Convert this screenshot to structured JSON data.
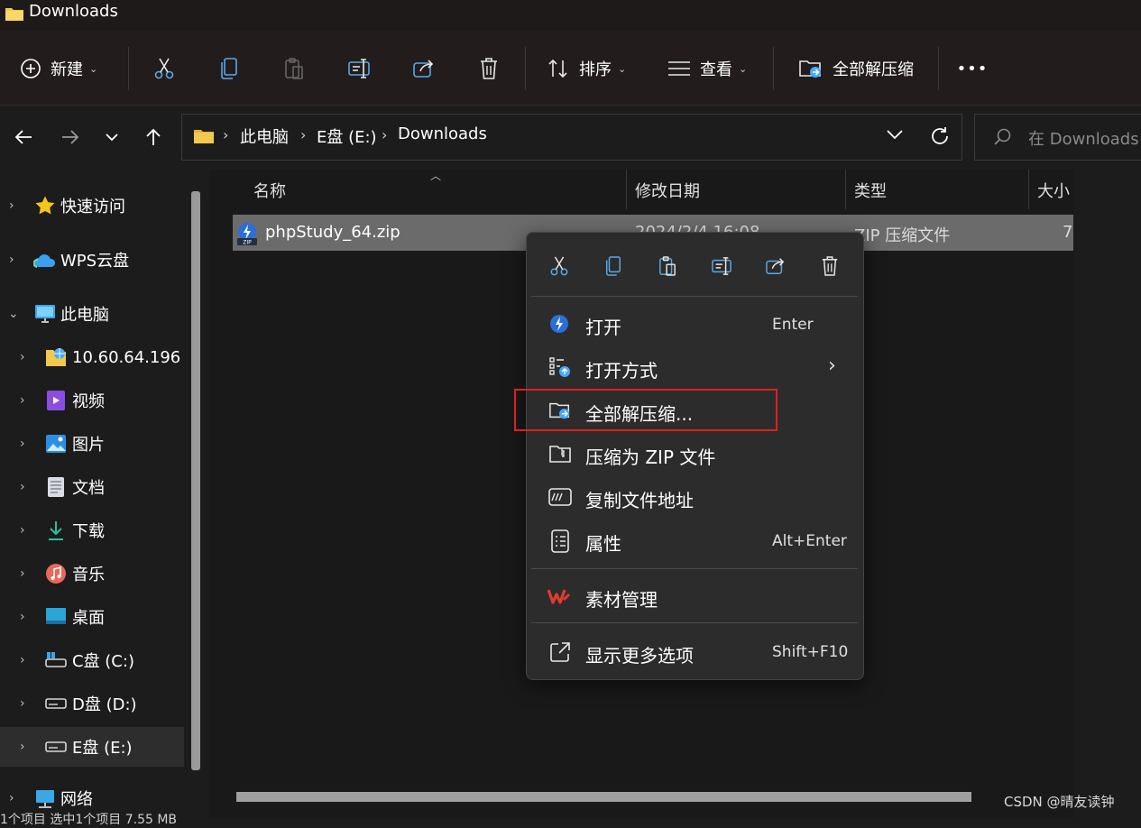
{
  "window": {
    "title": "Downloads"
  },
  "toolbar": {
    "new_label": "新建",
    "sort_label": "排序",
    "view_label": "查看",
    "extract_all_label": "全部解压缩",
    "more_label": "•••"
  },
  "nav": {
    "breadcrumbs": [
      "此电脑",
      "E盘 (E:)",
      "Downloads"
    ],
    "search_placeholder": "在 Downloads"
  },
  "sidebar": {
    "items": [
      {
        "label": "快速访问"
      },
      {
        "label": "WPS云盘"
      },
      {
        "label": "此电脑"
      },
      {
        "label": "10.60.64.196"
      },
      {
        "label": "视频"
      },
      {
        "label": "图片"
      },
      {
        "label": "文档"
      },
      {
        "label": "下载"
      },
      {
        "label": "音乐"
      },
      {
        "label": "桌面"
      },
      {
        "label": "C盘 (C:)"
      },
      {
        "label": "D盘 (D:)"
      },
      {
        "label": "E盘 (E:)"
      },
      {
        "label": "网络"
      }
    ]
  },
  "filelist": {
    "columns": [
      "名称",
      "修改日期",
      "类型",
      "大小"
    ],
    "rows": [
      {
        "name": "phpStudy_64.zip",
        "modified": "2024/2/4 16:08",
        "type": "ZIP 压缩文件",
        "size": "7"
      }
    ]
  },
  "context_menu": {
    "items": [
      {
        "label": "打开",
        "shortcut": "Enter"
      },
      {
        "label": "打开方式",
        "shortcut": "›"
      },
      {
        "label": "全部解压缩...",
        "shortcut": ""
      },
      {
        "label": "压缩为 ZIP 文件",
        "shortcut": ""
      },
      {
        "label": "复制文件地址",
        "shortcut": ""
      },
      {
        "label": "属性",
        "shortcut": "Alt+Enter"
      },
      {
        "label": "素材管理",
        "shortcut": ""
      },
      {
        "label": "显示更多选项",
        "shortcut": "Shift+F10"
      }
    ]
  },
  "status": {
    "partial": "1个项目  选中1个项目 7.55 MB"
  },
  "watermark": "CSDN @晴友读钟",
  "colors": {
    "highlight": "#e02020",
    "accent": "#4aa8ff",
    "wps_red": "#e33b2e",
    "folder": "#f2c94c"
  }
}
